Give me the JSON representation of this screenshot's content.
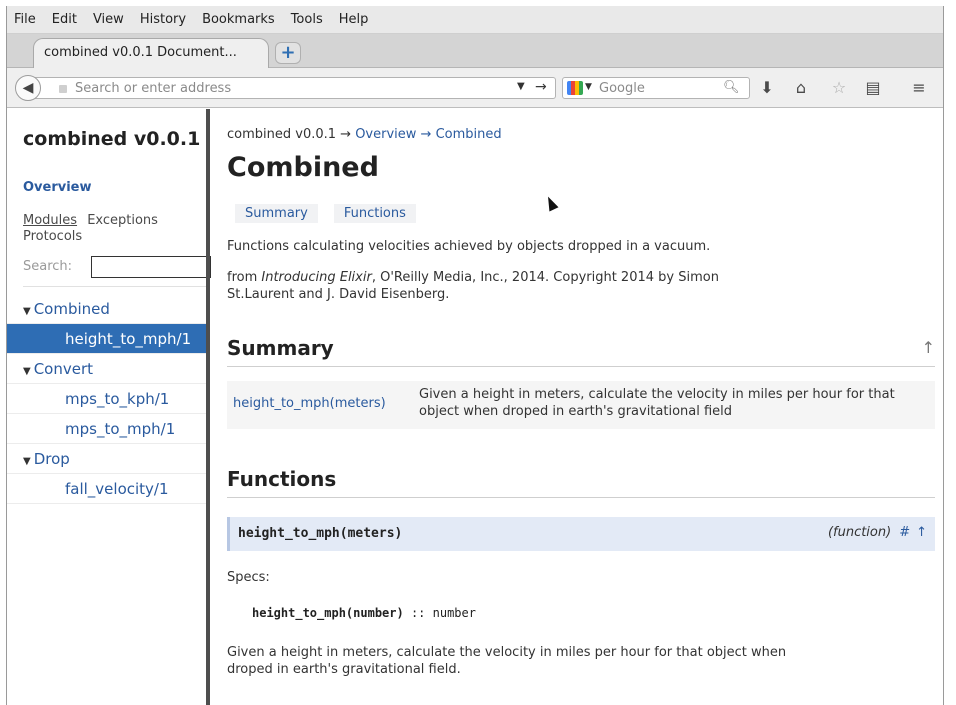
{
  "menubar": {
    "items": [
      "File",
      "Edit",
      "View",
      "History",
      "Bookmarks",
      "Tools",
      "Help"
    ]
  },
  "tab": {
    "title": "combined v0.0.1 Document..."
  },
  "toolbar": {
    "address_placeholder": "Search or enter address",
    "search_placeholder": "Google",
    "icons": [
      "back-icon",
      "dropdown-icon",
      "go-icon",
      "google-icon",
      "magnifier-icon",
      "download-icon",
      "home-icon",
      "bookmark-star-icon",
      "reading-list-icon",
      "menu-icon"
    ]
  },
  "sidebar": {
    "project_title": "combined v0.0.1",
    "overview_link": "Overview",
    "tabs": [
      "Modules",
      "Exceptions",
      "Protocols"
    ],
    "search_label": "Search:",
    "tree": [
      {
        "label": "Combined",
        "level": 0,
        "active": false
      },
      {
        "label": "height_to_mph/1",
        "level": 1,
        "active": true
      },
      {
        "label": "Convert",
        "level": 0,
        "active": false
      },
      {
        "label": "mps_to_kph/1",
        "level": 1,
        "active": false
      },
      {
        "label": "mps_to_mph/1",
        "level": 1,
        "active": false
      },
      {
        "label": "Drop",
        "level": 0,
        "active": false
      },
      {
        "label": "fall_velocity/1",
        "level": 1,
        "active": false
      }
    ]
  },
  "content": {
    "breadcrumb": {
      "root": "combined v0.0.1",
      "arrow1": " → ",
      "overview": "Overview",
      "arrow2": " → ",
      "current": "Combined"
    },
    "title": "Combined",
    "pills": [
      "Summary",
      "Functions"
    ],
    "description": "Functions calculating velocities achieved by objects dropped in a vacuum.",
    "source_prefix": "from ",
    "source_book": "Introducing Elixir",
    "source_rest": ", O'Reilly Media, Inc., 2014. Copyright 2014 by Simon St.Laurent and J. David Eisenberg.",
    "summary_heading": "Summary",
    "summary_rows": [
      {
        "name": "height_to_mph(meters)",
        "desc": "Given a height in meters, calculate the velocity in miles per hour for that object when droped in earth's gravitational field"
      }
    ],
    "functions_heading": "Functions",
    "function": {
      "signature": "height_to_mph(meters)",
      "kind": "(function)",
      "anchor": "#",
      "top_link": "↑",
      "specs_label": "Specs:",
      "spec_name": "height_to_mph(number)",
      "spec_rest": " :: number",
      "doc": "Given a height in meters, calculate the velocity in miles per hour for that object when droped in earth's gravitational field."
    },
    "up_arrow": "↑"
  }
}
